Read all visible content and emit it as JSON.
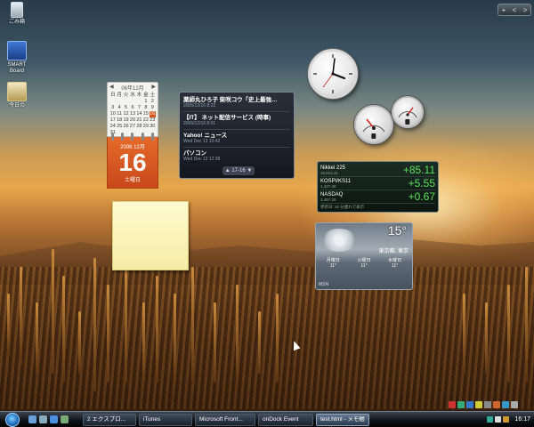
{
  "desktop_icons": [
    {
      "label": "ごみ箱",
      "icon": "recycle-bin-icon"
    },
    {
      "label": "SMART Board",
      "icon": "smartboard-icon"
    },
    {
      "label": "今日の",
      "icon": "app-shortcut-icon"
    }
  ],
  "calendar": {
    "header": "06年12月",
    "days_grid": [
      "日",
      "月",
      "火",
      "水",
      "木",
      "金",
      "土",
      "",
      "",
      "",
      "",
      "",
      "1",
      "2",
      "3",
      "4",
      "5",
      "6",
      "7",
      "8",
      "9",
      "10",
      "11",
      "12",
      "13",
      "14",
      "15",
      "16",
      "17",
      "18",
      "19",
      "20",
      "21",
      "22",
      "23",
      "24",
      "25",
      "26",
      "27",
      "28",
      "29",
      "30",
      "31"
    ],
    "selected_day": "16",
    "month_label": "2006 12月",
    "day": "16",
    "weekday": "土曜日"
  },
  "news_feed": {
    "items": [
      {
        "title": "薬師丸ひろ子 柴咲コウ「史上最強…",
        "meta": "2006/12/16 8:23"
      },
      {
        "title": "【IT】 ネット配信サービス (時事)",
        "meta": "2006/12/16 8:01"
      },
      {
        "title": "Yahoo! ニュース",
        "meta": "Wed Dec 13 10:42"
      },
      {
        "title": "パソコン",
        "meta": "Wed Dec 13 12:38"
      }
    ],
    "pager": "17-16"
  },
  "stocks": {
    "rows": [
      {
        "name": "Nikkei 225",
        "sub": "16,914.31",
        "change": "+85.11"
      },
      {
        "name": "KOSPI/KS11",
        "sub": "1,427.40",
        "change": "+5.55"
      },
      {
        "name": "NASDAQ",
        "sub": "2,457.20",
        "change": "+0.67"
      }
    ],
    "footer": "更新日: 20 分遅れで表示"
  },
  "weather": {
    "temp": "15°",
    "city": "東京都, 東京",
    "days": [
      {
        "label": "月曜日",
        "temp": "11°"
      },
      {
        "label": "火曜日",
        "temp": "11°"
      },
      {
        "label": "水曜日",
        "temp": "11°"
      }
    ],
    "footer": "MSN"
  },
  "taskbar": {
    "buttons": [
      {
        "label": "2 エクスプロ...",
        "active": false
      },
      {
        "label": "iTunes",
        "active": false
      },
      {
        "label": "Microsoft Front...",
        "active": false
      },
      {
        "label": "onDock Event",
        "active": false
      },
      {
        "label": "test.html - メモ帳",
        "active": true
      }
    ],
    "clock": "16:17"
  },
  "sidebar_controls": [
    "+",
    "<",
    ">"
  ]
}
